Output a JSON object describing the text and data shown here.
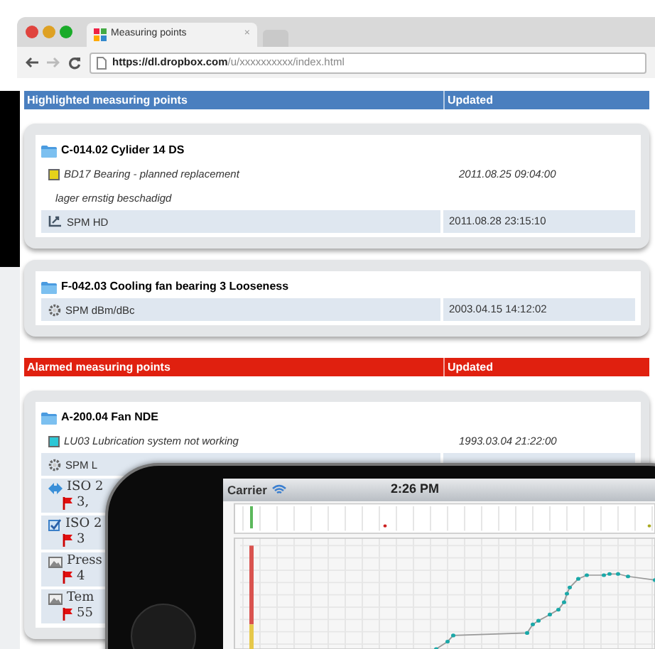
{
  "browser": {
    "tab_title": "Measuring points",
    "tab_close": "×",
    "url_host": "https://dl.dropbox.com",
    "url_path": "/u/xxxxxxxxxx/index.html"
  },
  "sections": [
    {
      "kind": "highlighted",
      "title": "Highlighted measuring points",
      "updated_label": "Updated",
      "points": [
        {
          "name": "C-014.02 Cylider 14 DS",
          "rows": [
            {
              "kind": "alarm",
              "color": "#e6d21a",
              "text": "BD17 Bearing - planned replacement",
              "date": "2011.08.25 09:04:00"
            },
            {
              "kind": "comment",
              "text": "lager ernstig beschadigd"
            },
            {
              "kind": "trend",
              "text": "SPM HD",
              "date": "2011.08.28 23:15:10"
            }
          ]
        },
        {
          "name": "F-042.03 Cooling fan bearing 3 Looseness",
          "rows": [
            {
              "kind": "gear",
              "text": "SPM dBm/dBc",
              "date": "2003.04.15 14:12:02"
            }
          ]
        }
      ]
    },
    {
      "kind": "alarmed",
      "title": "Alarmed measuring points",
      "updated_label": "Updated",
      "points": [
        {
          "name": "A-200.04 Fan NDE",
          "rows": [
            {
              "kind": "alarm",
              "color": "#2cc7d6",
              "text": "LU03 Lubrication system not working",
              "date": "1993.03.04 21:22:00"
            },
            {
              "kind": "gear",
              "text": "SPM L"
            },
            {
              "kind": "iso",
              "text": "ISO 2",
              "flag": "3,"
            },
            {
              "kind": "iso-checked",
              "text": "ISO 2",
              "flag": "3"
            },
            {
              "kind": "image",
              "text": "Press",
              "flag": "4"
            },
            {
              "kind": "image",
              "text": "Tem",
              "flag": "55"
            }
          ]
        }
      ]
    }
  ],
  "phone": {
    "carrier": "Carrier",
    "time": "2:26 PM"
  }
}
